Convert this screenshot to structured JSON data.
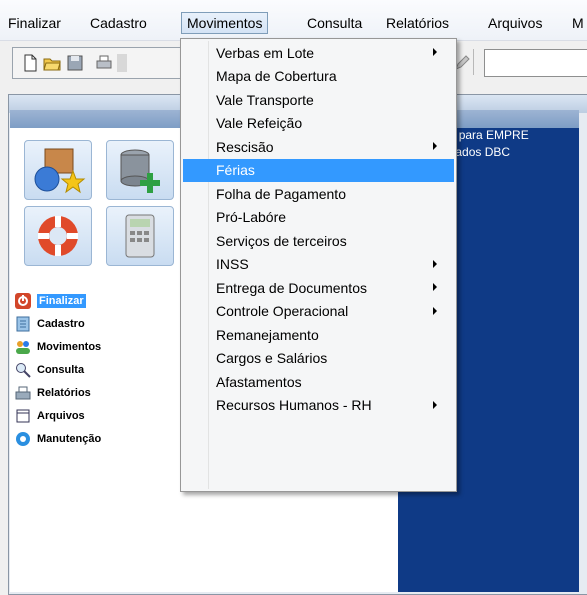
{
  "menubar": {
    "items": [
      "Finalizar",
      "Cadastro",
      "Movimentos",
      "Consulta",
      "Relatórios",
      "Arquivos",
      "M"
    ],
    "active_index": 2
  },
  "right_panel": {
    "line1": "nciado para EMPRE",
    "line2": "e de Dados DBC"
  },
  "side_menu": {
    "items": [
      {
        "label": "Finalizar",
        "icon": "power-icon",
        "selected": true
      },
      {
        "label": "Cadastro",
        "icon": "notebook-icon",
        "selected": false
      },
      {
        "label": "Movimentos",
        "icon": "people-icon",
        "selected": false
      },
      {
        "label": "Consulta",
        "icon": "magnifier-icon",
        "selected": false
      },
      {
        "label": "Relatórios",
        "icon": "report-icon",
        "selected": false
      },
      {
        "label": "Arquivos",
        "icon": "file-icon",
        "selected": false
      },
      {
        "label": "Manutenção",
        "icon": "gear-icon",
        "selected": false
      }
    ]
  },
  "dropdown": {
    "items": [
      {
        "label": "Verbas em Lote",
        "submenu": true,
        "highlighted": false
      },
      {
        "label": "Mapa de Cobertura",
        "submenu": false,
        "highlighted": false
      },
      {
        "label": "Vale Transporte",
        "submenu": false,
        "highlighted": false
      },
      {
        "label": "Vale Refeição",
        "submenu": false,
        "highlighted": false
      },
      {
        "label": "Rescisão",
        "submenu": true,
        "highlighted": false
      },
      {
        "label": "Férias",
        "submenu": false,
        "highlighted": true
      },
      {
        "label": "Folha de Pagamento",
        "submenu": false,
        "highlighted": false
      },
      {
        "label": "Pró-Labóre",
        "submenu": false,
        "highlighted": false
      },
      {
        "label": "Serviços de terceiros",
        "submenu": false,
        "highlighted": false
      },
      {
        "label": "INSS",
        "submenu": true,
        "highlighted": false
      },
      {
        "label": "Entrega de Documentos",
        "submenu": true,
        "highlighted": false
      },
      {
        "label": "Controle Operacional",
        "submenu": true,
        "highlighted": false
      },
      {
        "label": "Remanejamento",
        "submenu": false,
        "highlighted": false
      },
      {
        "label": "Cargos e Salários",
        "submenu": false,
        "highlighted": false
      },
      {
        "label": "Afastamentos",
        "submenu": false,
        "highlighted": false
      },
      {
        "label": "Recursos Humanos - RH",
        "submenu": true,
        "highlighted": false
      }
    ]
  },
  "colors": {
    "highlight": "#3399ff",
    "right_panel": "#0f3a86"
  }
}
